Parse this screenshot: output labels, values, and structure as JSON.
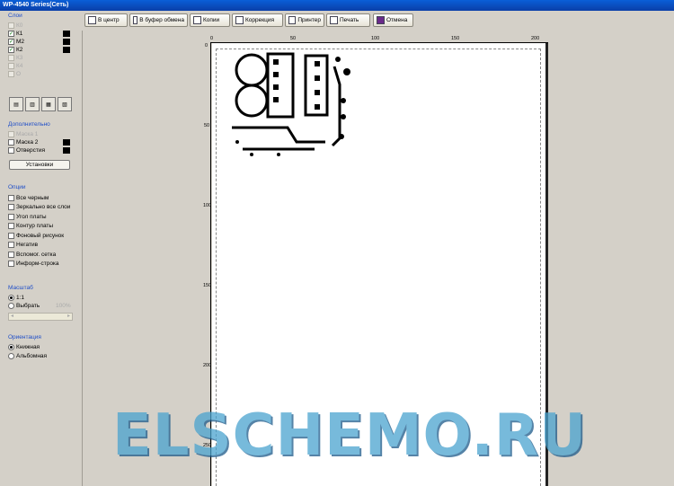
{
  "window": {
    "title": "WP-4540 Series(Сеть)"
  },
  "sidebar": {
    "layers_title": "Слои",
    "layers": [
      {
        "label": "К0",
        "checked": false,
        "enabled": false,
        "swatch": false
      },
      {
        "label": "К1",
        "checked": true,
        "enabled": true,
        "swatch": true
      },
      {
        "label": "М2",
        "checked": true,
        "enabled": true,
        "swatch": true
      },
      {
        "label": "К2",
        "checked": true,
        "enabled": true,
        "swatch": true
      },
      {
        "label": "К3",
        "checked": false,
        "enabled": false,
        "swatch": false
      },
      {
        "label": "К4",
        "checked": false,
        "enabled": false,
        "swatch": false
      },
      {
        "label": "О",
        "checked": false,
        "enabled": false,
        "swatch": false
      }
    ],
    "additional_title": "Дополнительно",
    "additional": [
      {
        "label": "Маска 1",
        "checked": false,
        "enabled": false,
        "swatch": false
      },
      {
        "label": "Маска 2",
        "checked": false,
        "enabled": true,
        "swatch": true
      },
      {
        "label": "Отверстия",
        "checked": false,
        "enabled": true,
        "swatch": true
      }
    ],
    "setup_button": "Установки",
    "options_title": "Опции",
    "options": [
      {
        "label": "Все черным"
      },
      {
        "label": "Зеркально все слои"
      },
      {
        "label": "Угол платы"
      },
      {
        "label": "Контур платы"
      },
      {
        "label": "Фоновый рисунок"
      },
      {
        "label": "Негатив"
      },
      {
        "label": "Вспомог. сетка"
      },
      {
        "label": "Информ-строка"
      }
    ],
    "scale_title": "Масштаб",
    "scale_options": [
      {
        "label": "1:1",
        "selected": true
      },
      {
        "label": "Выбрать",
        "selected": false
      }
    ],
    "scale_value": "100%",
    "orientation_title": "Ориентация",
    "orientation_options": [
      {
        "label": "Книжная",
        "selected": true
      },
      {
        "label": "Альбомная",
        "selected": false
      }
    ]
  },
  "toolbar": {
    "buttons": [
      {
        "label": "В центр",
        "icon": "center-icon"
      },
      {
        "label": "В буфер обмена",
        "icon": "clipboard-icon"
      },
      {
        "label": "Копии",
        "icon": "copies-icon"
      },
      {
        "label": "Коррекция",
        "icon": "correction-icon"
      },
      {
        "label": "Принтер",
        "icon": "printer-icon"
      },
      {
        "label": "Печать",
        "icon": "print-icon"
      },
      {
        "label": "Отмена",
        "icon": "cancel-icon"
      }
    ]
  },
  "ruler": {
    "top_labels": [
      "0",
      "50",
      "100",
      "150",
      "200"
    ],
    "left_labels": [
      "0",
      "50",
      "100",
      "150",
      "200",
      "250"
    ]
  },
  "watermark": {
    "text": "ELSCHEMO.RU"
  },
  "colors": {
    "titlebar": "#0a4fc8",
    "section_title": "#1f4ec8",
    "panel": "#d4d0c8",
    "watermark": "#4aa3cf"
  }
}
